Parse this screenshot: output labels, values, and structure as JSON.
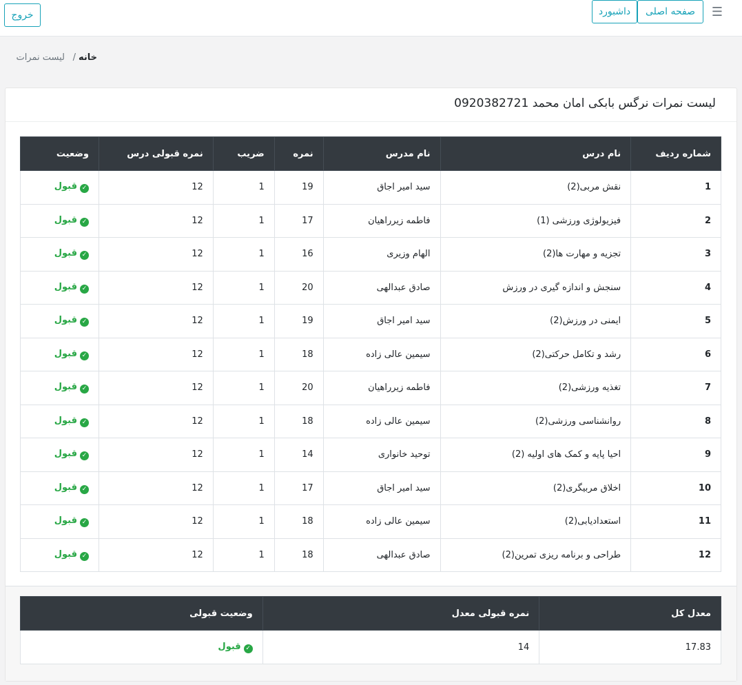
{
  "header": {
    "menu_icon": "hamburger-icon",
    "home_label": "صفحه اصلی",
    "dashboard_label": "داشبورد",
    "logout_label": "خروج"
  },
  "breadcrumb": {
    "home": "خانه",
    "separator": "/",
    "current": "لیست نمرات"
  },
  "card": {
    "title": "لیست نمرات نرگس بابکی امان محمد 0920382721"
  },
  "grades_table": {
    "headers": [
      "شماره ردیف",
      "نام درس",
      "نام مدرس",
      "نمره",
      "ضریب",
      "نمره قبولی درس",
      "وضعیت"
    ],
    "rows": [
      {
        "num": "1",
        "course": "نقش مربی(2)",
        "teacher": "سید امیر اجاق",
        "grade": "19",
        "coef": "1",
        "pass": "12",
        "status": "قبول"
      },
      {
        "num": "2",
        "course": "فیزیولوژی ورزشی (1)",
        "teacher": "فاطمه زیرراهیان",
        "grade": "17",
        "coef": "1",
        "pass": "12",
        "status": "قبول"
      },
      {
        "num": "3",
        "course": "تجزیه و مهارت ها(2)",
        "teacher": "الهام وزیری",
        "grade": "16",
        "coef": "1",
        "pass": "12",
        "status": "قبول"
      },
      {
        "num": "4",
        "course": "سنجش و اندازه گیری در ورزش",
        "teacher": "صادق عبدالهی",
        "grade": "20",
        "coef": "1",
        "pass": "12",
        "status": "قبول"
      },
      {
        "num": "5",
        "course": "ایمنی در ورزش(2)",
        "teacher": "سید امیر اجاق",
        "grade": "19",
        "coef": "1",
        "pass": "12",
        "status": "قبول"
      },
      {
        "num": "6",
        "course": "رشد و تکامل حرکتی(2)",
        "teacher": "سیمین عالی زاده",
        "grade": "18",
        "coef": "1",
        "pass": "12",
        "status": "قبول"
      },
      {
        "num": "7",
        "course": "تغذیه ورزشی(2)",
        "teacher": "فاطمه زیرراهیان",
        "grade": "20",
        "coef": "1",
        "pass": "12",
        "status": "قبول"
      },
      {
        "num": "8",
        "course": "روانشناسی ورزشی(2)",
        "teacher": "سیمین عالی زاده",
        "grade": "18",
        "coef": "1",
        "pass": "12",
        "status": "قبول"
      },
      {
        "num": "9",
        "course": "احیا پایه و کمک های اولیه (2)",
        "teacher": "توحید خانواری",
        "grade": "14",
        "coef": "1",
        "pass": "12",
        "status": "قبول"
      },
      {
        "num": "10",
        "course": "اخلاق مربیگری(2)",
        "teacher": "سید امیر اجاق",
        "grade": "17",
        "coef": "1",
        "pass": "12",
        "status": "قبول"
      },
      {
        "num": "11",
        "course": "استعدادیابی(2)",
        "teacher": "سیمین عالی زاده",
        "grade": "18",
        "coef": "1",
        "pass": "12",
        "status": "قبول"
      },
      {
        "num": "12",
        "course": "طراحی و برنامه ریزی تمرین(2)",
        "teacher": "صادق عبدالهی",
        "grade": "18",
        "coef": "1",
        "pass": "12",
        "status": "قبول"
      }
    ]
  },
  "summary_table": {
    "headers": [
      "معدل کل",
      "نمره قبولی معدل",
      "وضعیت قبولی"
    ],
    "average": "17.83",
    "pass_average": "14",
    "status": "قبول"
  },
  "colors": {
    "accent": "#17a2b8",
    "success": "#28a745",
    "table_header": "#343a40"
  }
}
